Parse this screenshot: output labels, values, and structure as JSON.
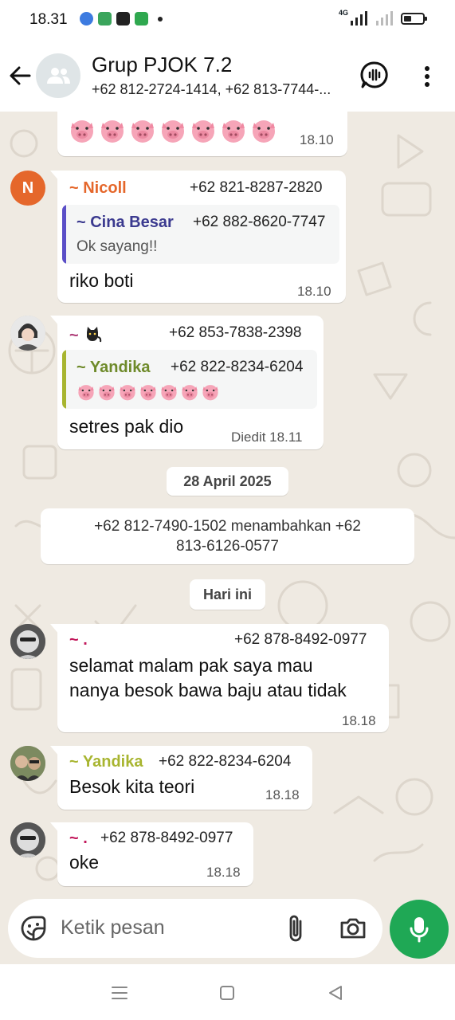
{
  "status_bar": {
    "time": "18.31",
    "network": "4G"
  },
  "header": {
    "title": "Grup PJOK 7.2",
    "subtitle": "+62 812-2724-1414, +62 813-7744-..."
  },
  "messages": {
    "m0": {
      "time": "18.10"
    },
    "m1": {
      "avatar_letter": "N",
      "sender": "~ Nicoll",
      "phone": "+62 821-8287-2820",
      "quote": {
        "sender": "~ Cina Besar",
        "phone": "+62 882-8620-7747",
        "text": "Ok sayang!!"
      },
      "text": "riko boti",
      "time": "18.10"
    },
    "m2": {
      "sender": "~",
      "phone": "+62 853-7838-2398",
      "quote": {
        "sender": "~ Yandika",
        "phone": "+62 822-8234-6204"
      },
      "text": "setres pak dio",
      "time": "Diedit 18.11"
    },
    "date_chip_1": "28 April 2025",
    "system_line1": "+62 812-7490-1502 menambahkan +62",
    "system_line2": "813-6126-0577",
    "date_chip_2": "Hari ini",
    "m3": {
      "sender": "~ .",
      "phone": "+62 878-8492-0977",
      "line1": "selamat malam pak saya mau",
      "line2": "nanya besok bawa baju atau tidak",
      "time": "18.18"
    },
    "m4": {
      "sender": "~ Yandika",
      "phone": "+62 822-8234-6204",
      "text": "Besok kita teori",
      "time": "18.18"
    },
    "m5": {
      "sender": "~ .",
      "phone": "+62 878-8492-0977",
      "text": "oke",
      "time": "18.18"
    }
  },
  "input": {
    "placeholder": "Ketik pesan"
  },
  "colors": {
    "nicoll": "#e5672b",
    "cina_besar": "#3b3a8f",
    "yandika": "#6e8a2a",
    "yandika_light": "#a8b530",
    "dot_sender": "#c2185b",
    "tilde_sender": "#b0407a",
    "quote_bar_purple": "#5b4fc7",
    "quote_bar_green": "#a8b530",
    "send_green": "#1fa855",
    "chat_bg": "#efeae2"
  }
}
